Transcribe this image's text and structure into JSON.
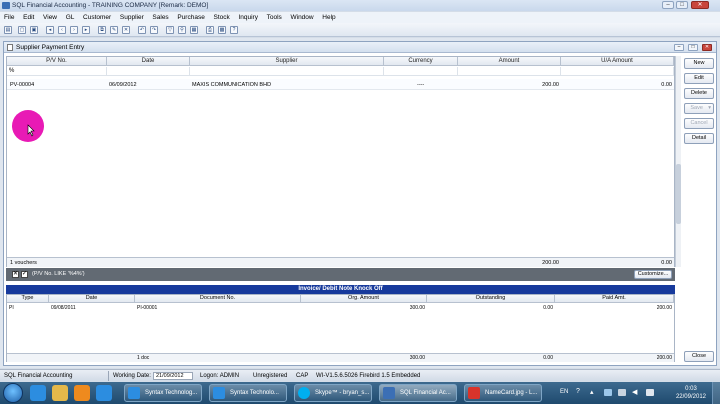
{
  "app": {
    "title": "SQL Financial Accounting - TRAINING COMPANY [Remark: DEMO]",
    "window_buttons": [
      "–",
      "□",
      "✕"
    ]
  },
  "menu": [
    "File",
    "Edit",
    "View",
    "GL",
    "Customer",
    "Supplier",
    "Sales",
    "Purchase",
    "Stock",
    "Inquiry",
    "Tools",
    "Window",
    "Help"
  ],
  "child": {
    "title": "Supplier Payment Entry",
    "buttons": [
      "–",
      "□",
      "✕"
    ]
  },
  "grid": {
    "columns": [
      "P/V No.",
      "Date",
      "Supplier",
      "Currency",
      "Amount",
      "U/A Amount"
    ],
    "filter_value": "%",
    "rows": [
      {
        "pv_no": "PV-00004",
        "date": "06/09/2012",
        "supplier": "MAXIS COMMUNICATION BHD",
        "currency": "----",
        "amount": "200.00",
        "ua_amount": "0.00"
      }
    ],
    "footer": {
      "count": "1 vouchers",
      "amount": "200.00",
      "ua_amount": "0.00"
    }
  },
  "side_buttons": {
    "new": "New",
    "edit": "Edit",
    "delete": "Delete",
    "save": "Save",
    "cancel": "Cancel",
    "detail": "Detail",
    "close": "Close"
  },
  "filterbar": {
    "close_mark": "✕",
    "check_mark": "✓",
    "text": "(P/V No. LIKE '%4%')",
    "customize": "Customize..."
  },
  "knockoff": {
    "title": "Invoice/ Debit Note Knock Off",
    "columns": [
      "Type",
      "Date",
      "Document No.",
      "Org. Amount",
      "Outstanding",
      "Paid Amt."
    ],
    "rows": [
      {
        "type": "PI",
        "date": "09/08/2011",
        "doc_no": "PI-00001",
        "org_amount": "300.00",
        "outstanding": "0.00",
        "paid_amt": "200.00"
      }
    ],
    "footer": {
      "count": "1 doc",
      "org_amount": "300.00",
      "outstanding": "0.00",
      "paid_amt": "200.00"
    }
  },
  "status": {
    "app": "SQL Financial Accounting",
    "working_date_label": "Working Date:",
    "working_date": "21/09/2012",
    "logon": "Logon: ADMIN",
    "registration": "Unregistered",
    "caps": "CAP",
    "version": "WI-V1.5.6.5026 Firebird 1.5 Embedded"
  },
  "taskbar": {
    "tasks": [
      {
        "label": "Syntax Technolog...",
        "color": "#2c8de0"
      },
      {
        "label": "Syntax Technolo...",
        "color": "#2c8de0"
      },
      {
        "label": "Skype™ - bryan_s...",
        "color": "#00aff0"
      },
      {
        "label": "SQL Financial Ac...",
        "color": "#3b6fb5"
      },
      {
        "label": "NameCard.jpg - L...",
        "color": "#d9342b"
      }
    ],
    "lang": "EN",
    "time": "0:03",
    "date": "22/09/2012"
  }
}
